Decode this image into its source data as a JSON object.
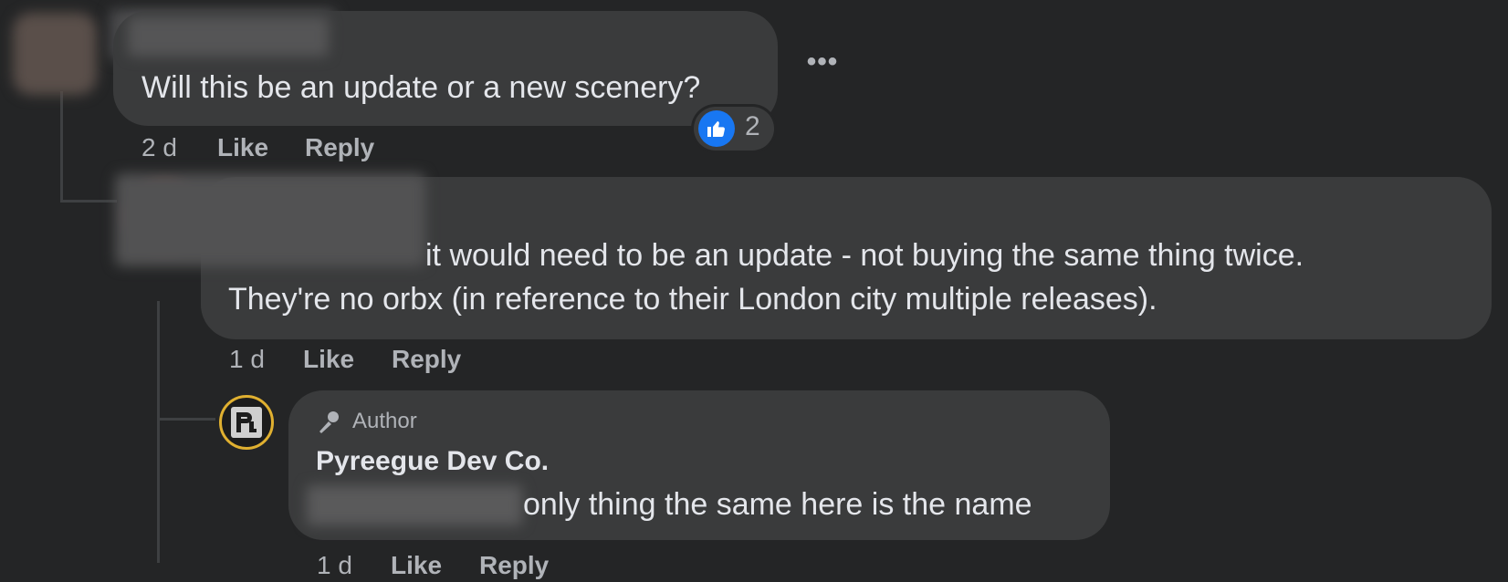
{
  "comments": [
    {
      "text": "Will this be an update or a new scenery?",
      "time": "2 d",
      "like_label": "Like",
      "reply_label": "Reply",
      "reaction_count": "2",
      "reaction_icon": "thumbs-up-icon"
    },
    {
      "text_line1": "it would need to be an update - not buying the same thing twice.",
      "text_line2": "They're no orbx (in reference to their London city multiple releases).",
      "time": "1 d",
      "like_label": "Like",
      "reply_label": "Reply"
    },
    {
      "author_badge": "Author",
      "author_name": "Pyreegue Dev Co.",
      "text": "only thing the same here is the name",
      "time": "1 d",
      "like_label": "Like",
      "reply_label": "Reply"
    }
  ],
  "more_options_label": "•••",
  "colors": {
    "background": "#242526",
    "bubble": "#3a3b3c",
    "text": "#e4e6eb",
    "secondary_text": "#b0b3b8",
    "like_blue": "#1877f2",
    "avatar_ring": "#e0b030"
  }
}
